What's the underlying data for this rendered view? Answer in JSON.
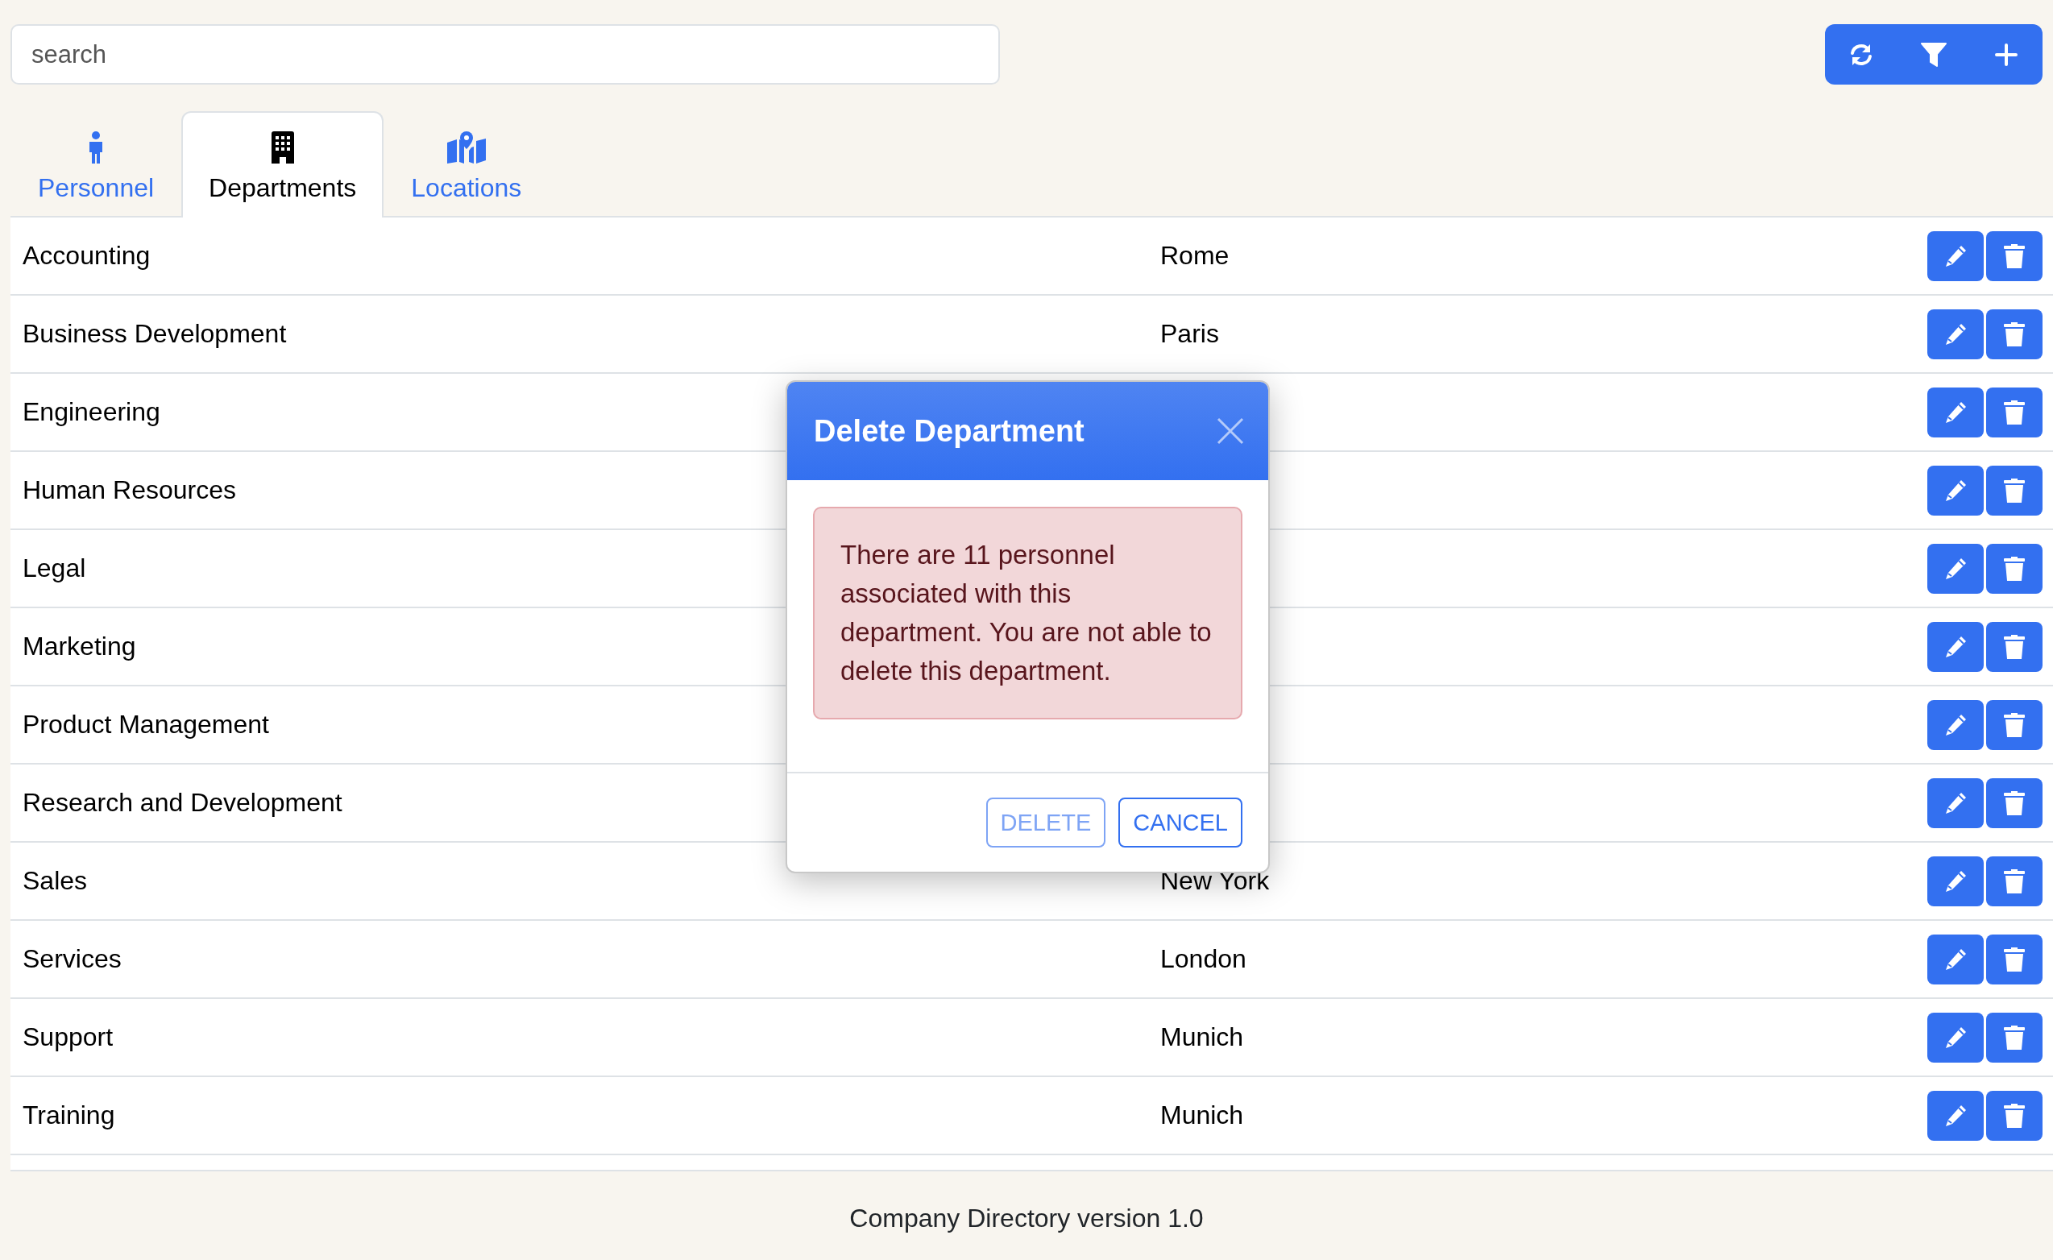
{
  "search": {
    "placeholder": "search"
  },
  "toolbar": [
    {
      "kind": "refresh"
    },
    {
      "kind": "filter"
    },
    {
      "kind": "add"
    }
  ],
  "tabs": [
    {
      "label": "Personnel",
      "kind": "person",
      "selected": false
    },
    {
      "label": "Departments",
      "kind": "building",
      "selected": true
    },
    {
      "label": "Locations",
      "kind": "map",
      "selected": false
    }
  ],
  "rows": [
    {
      "department": "Accounting",
      "location": "Rome"
    },
    {
      "department": "Business Development",
      "location": "Paris"
    },
    {
      "department": "Engineering"
    },
    {
      "department": "Human Resources"
    },
    {
      "department": "Legal"
    },
    {
      "department": "Marketing"
    },
    {
      "department": "Product Management"
    },
    {
      "department": "Research and Development"
    },
    {
      "department": "Sales",
      "location": "New York"
    },
    {
      "department": "Services",
      "location": "London"
    },
    {
      "department": "Support",
      "location": "Munich"
    },
    {
      "department": "Training",
      "location": "Munich"
    }
  ],
  "modal": {
    "title": "Delete Department",
    "message": "There are 11 personnel associated with this department. You are not able to delete this department.",
    "buttons": [
      {
        "label": "DELETE",
        "disabled": true
      },
      {
        "label": "CANCEL",
        "disabled": false
      }
    ]
  },
  "footer": "Company Directory version 1.0"
}
